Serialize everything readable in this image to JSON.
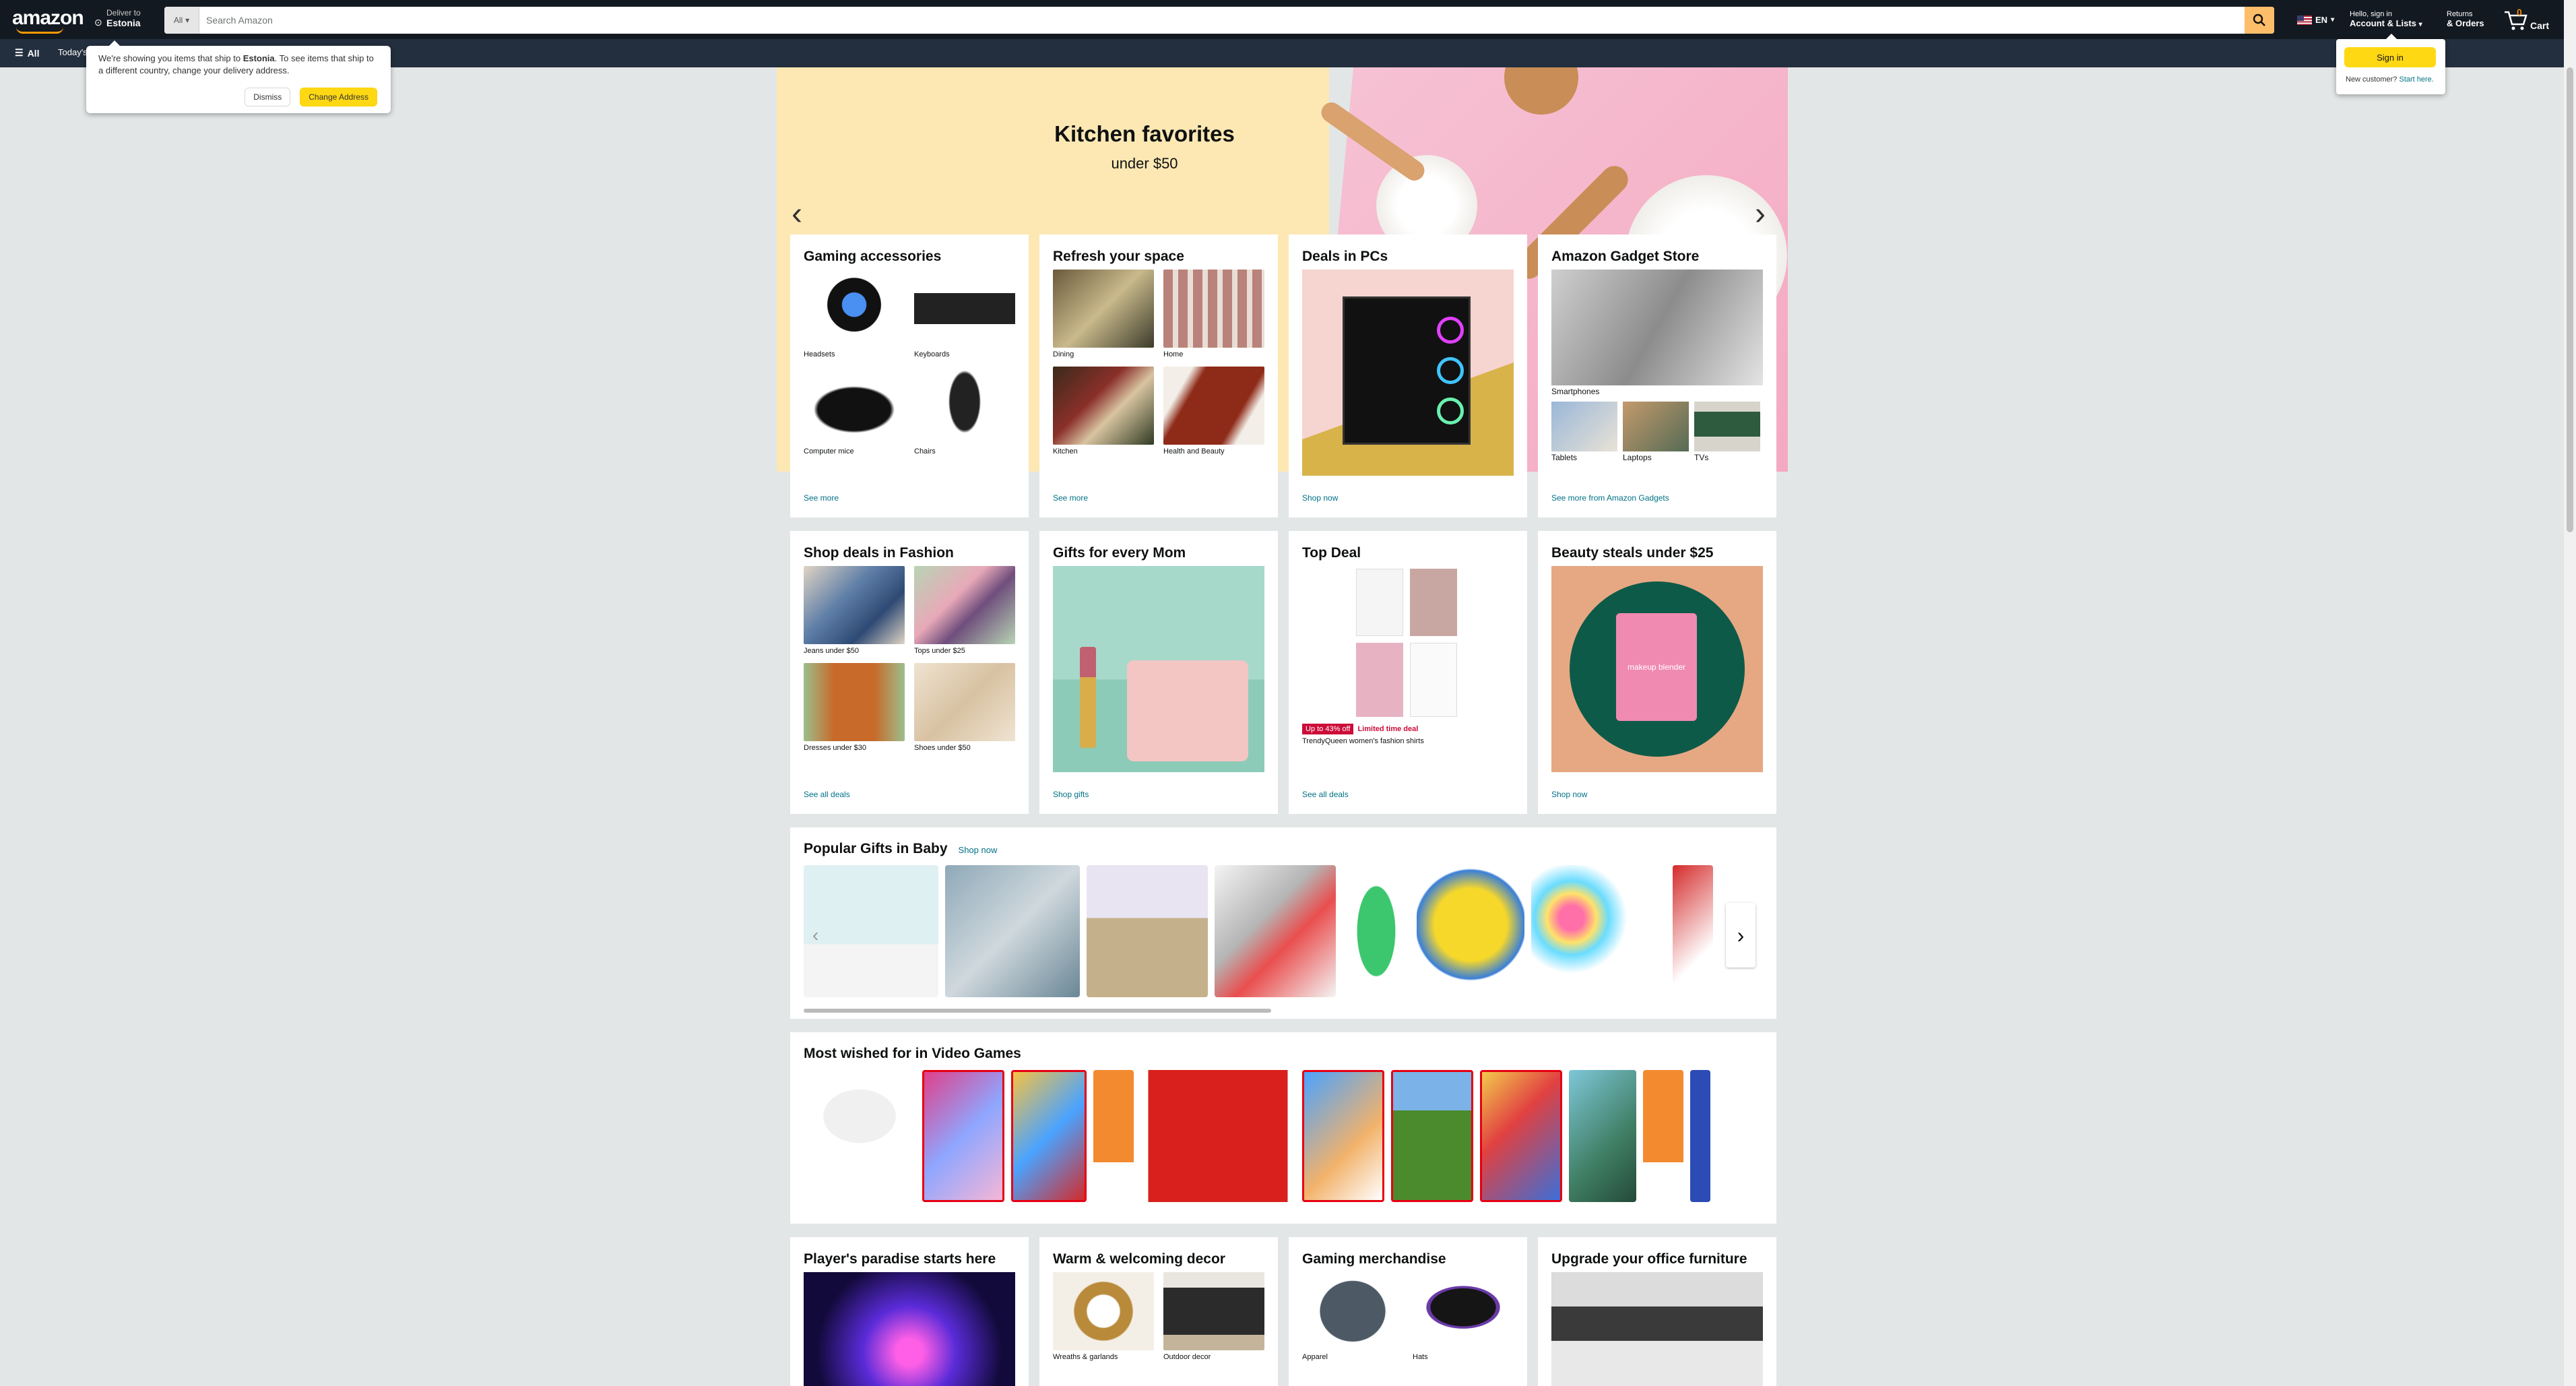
{
  "header": {
    "logo": "amazon",
    "deliver_line1": "Deliver to",
    "deliver_line2": "Estonia",
    "search_category": "All",
    "search_placeholder": "Search Amazon",
    "lang": "EN",
    "account_line1": "Hello, sign in",
    "account_line2": "Account & Lists",
    "returns_line1": "Returns",
    "returns_line2": "& Orders",
    "cart_count": "0",
    "cart_label": "Cart"
  },
  "subnav": {
    "all": "All",
    "today": "Today's"
  },
  "country_popover": {
    "text_a": "We're showing you items that ship to ",
    "text_country": "Estonia",
    "text_b": ". To see items that ship to a different country, change your delivery address.",
    "dismiss": "Dismiss",
    "change": "Change Address"
  },
  "signin_popover": {
    "button": "Sign in",
    "new_customer": "New customer?",
    "start_here": "Start here."
  },
  "hero": {
    "title": "Kitchen favorites",
    "subtitle": "under $50"
  },
  "cards": {
    "gaming": {
      "title": "Gaming accessories",
      "items": [
        "Headsets",
        "Keyboards",
        "Computer mice",
        "Chairs"
      ],
      "link": "See more"
    },
    "refresh": {
      "title": "Refresh your space",
      "items": [
        "Dining",
        "Home",
        "Kitchen",
        "Health and Beauty"
      ],
      "link": "See more"
    },
    "pcs": {
      "title": "Deals in PCs",
      "link": "Shop now"
    },
    "gadget": {
      "title": "Amazon Gadget Store",
      "main_label": "Smartphones",
      "items": [
        "Tablets",
        "Laptops",
        "TVs"
      ],
      "link": "See more from Amazon Gadgets"
    },
    "fashion": {
      "title": "Shop deals in Fashion",
      "items": [
        "Jeans under $50",
        "Tops under $25",
        "Dresses under $30",
        "Shoes under $50"
      ],
      "link": "See all deals"
    },
    "mom": {
      "title": "Gifts for every Mom",
      "link": "Shop gifts"
    },
    "topdeal": {
      "title": "Top Deal",
      "badge": "Up to 43% off",
      "badge2": "Limited time deal",
      "desc": "TrendyQueen women's fashion shirts",
      "link": "See all deals"
    },
    "beauty": {
      "title": "Beauty steals under $25",
      "product_text": "makeup blender",
      "link": "Shop now"
    },
    "player": {
      "title": "Player's paradise starts here"
    },
    "warm": {
      "title": "Warm & welcoming decor",
      "items": [
        "Wreaths & garlands",
        "Outdoor decor"
      ]
    },
    "merch": {
      "title": "Gaming merchandise",
      "items": [
        "Apparel",
        "Hats"
      ]
    },
    "office": {
      "title": "Upgrade your office furniture"
    }
  },
  "baby_strip": {
    "title": "Popular Gifts in Baby",
    "link": "Shop now"
  },
  "games_strip": {
    "title": "Most wished for in Video Games"
  }
}
